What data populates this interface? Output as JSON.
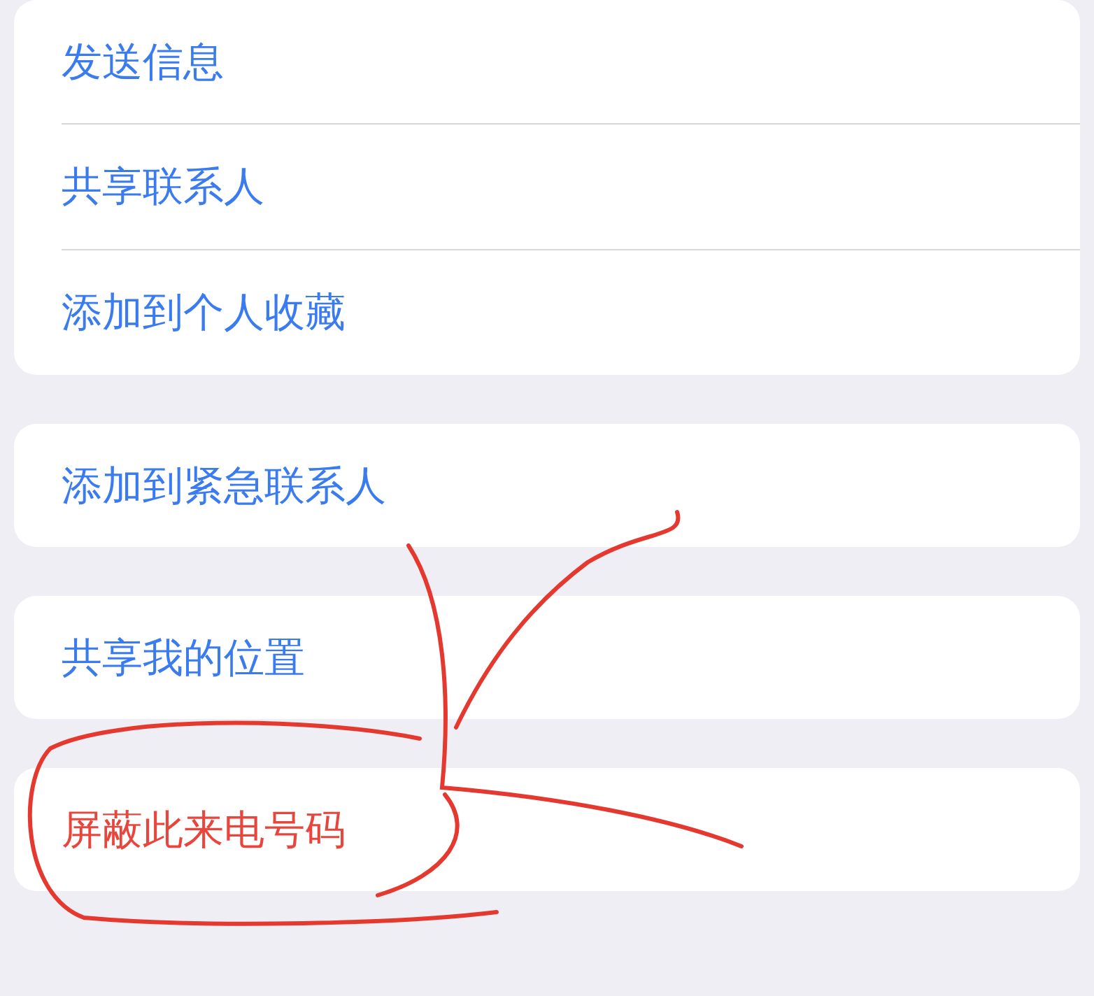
{
  "groups": [
    {
      "items": [
        {
          "label": "发送信息",
          "kind": "action"
        },
        {
          "label": "共享联系人",
          "kind": "action"
        },
        {
          "label": "添加到个人收藏",
          "kind": "action"
        }
      ]
    },
    {
      "items": [
        {
          "label": "添加到紧急联系人",
          "kind": "action"
        }
      ]
    },
    {
      "items": [
        {
          "label": "共享我的位置",
          "kind": "action"
        }
      ]
    },
    {
      "items": [
        {
          "label": "屏蔽此来电号码",
          "kind": "destructive"
        }
      ]
    }
  ]
}
